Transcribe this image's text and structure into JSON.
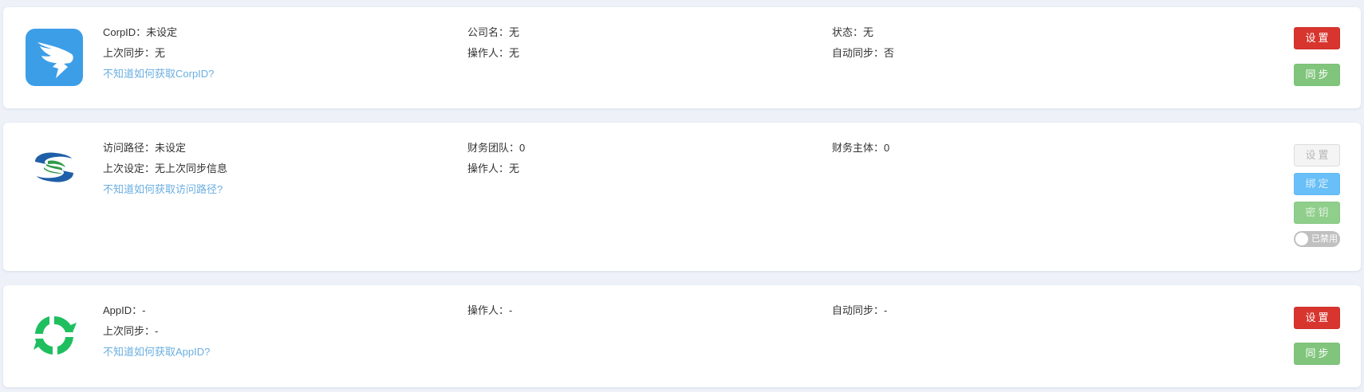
{
  "cards": [
    {
      "logo": "dingtalk-logo",
      "fields": {
        "corpid": "CorpID：未设定",
        "company": "公司名：无",
        "status": "状态：无",
        "last_sync": "上次同步：无",
        "operator": "操作人：无",
        "auto_sync": "自动同步：否"
      },
      "help_link": "不知道如何获取CorpID?",
      "buttons": {
        "settings": "设置",
        "sync": "同步"
      }
    },
    {
      "logo": "bank-logo",
      "fields": {
        "access_path": "访问路径：未设定",
        "finance_team": "财务团队：0",
        "finance_entity": "财务主体：0",
        "last_setting": "上次设定：无上次同步信息",
        "operator": "操作人：无"
      },
      "help_link": "不知道如何获取访问路径?",
      "buttons": {
        "settings": "设置",
        "bind": "绑定",
        "key": "密钥"
      },
      "toggle": {
        "label": "已禁用",
        "enabled": false
      }
    },
    {
      "logo": "wechat-work-logo",
      "fields": {
        "appid": "AppID：-",
        "operator": "操作人：-",
        "auto_sync": "自动同步：-",
        "last_sync": "上次同步：-"
      },
      "help_link": "不知道如何获取AppID?",
      "buttons": {
        "settings": "设置",
        "sync": "同步"
      }
    }
  ],
  "colors": {
    "background": "#eef1f8",
    "card": "#ffffff",
    "link": "#6aaee0",
    "danger": "#d8352f",
    "success": "#81c57d",
    "primary": "#69bff7",
    "toggle_off": "#c0c0c0"
  }
}
